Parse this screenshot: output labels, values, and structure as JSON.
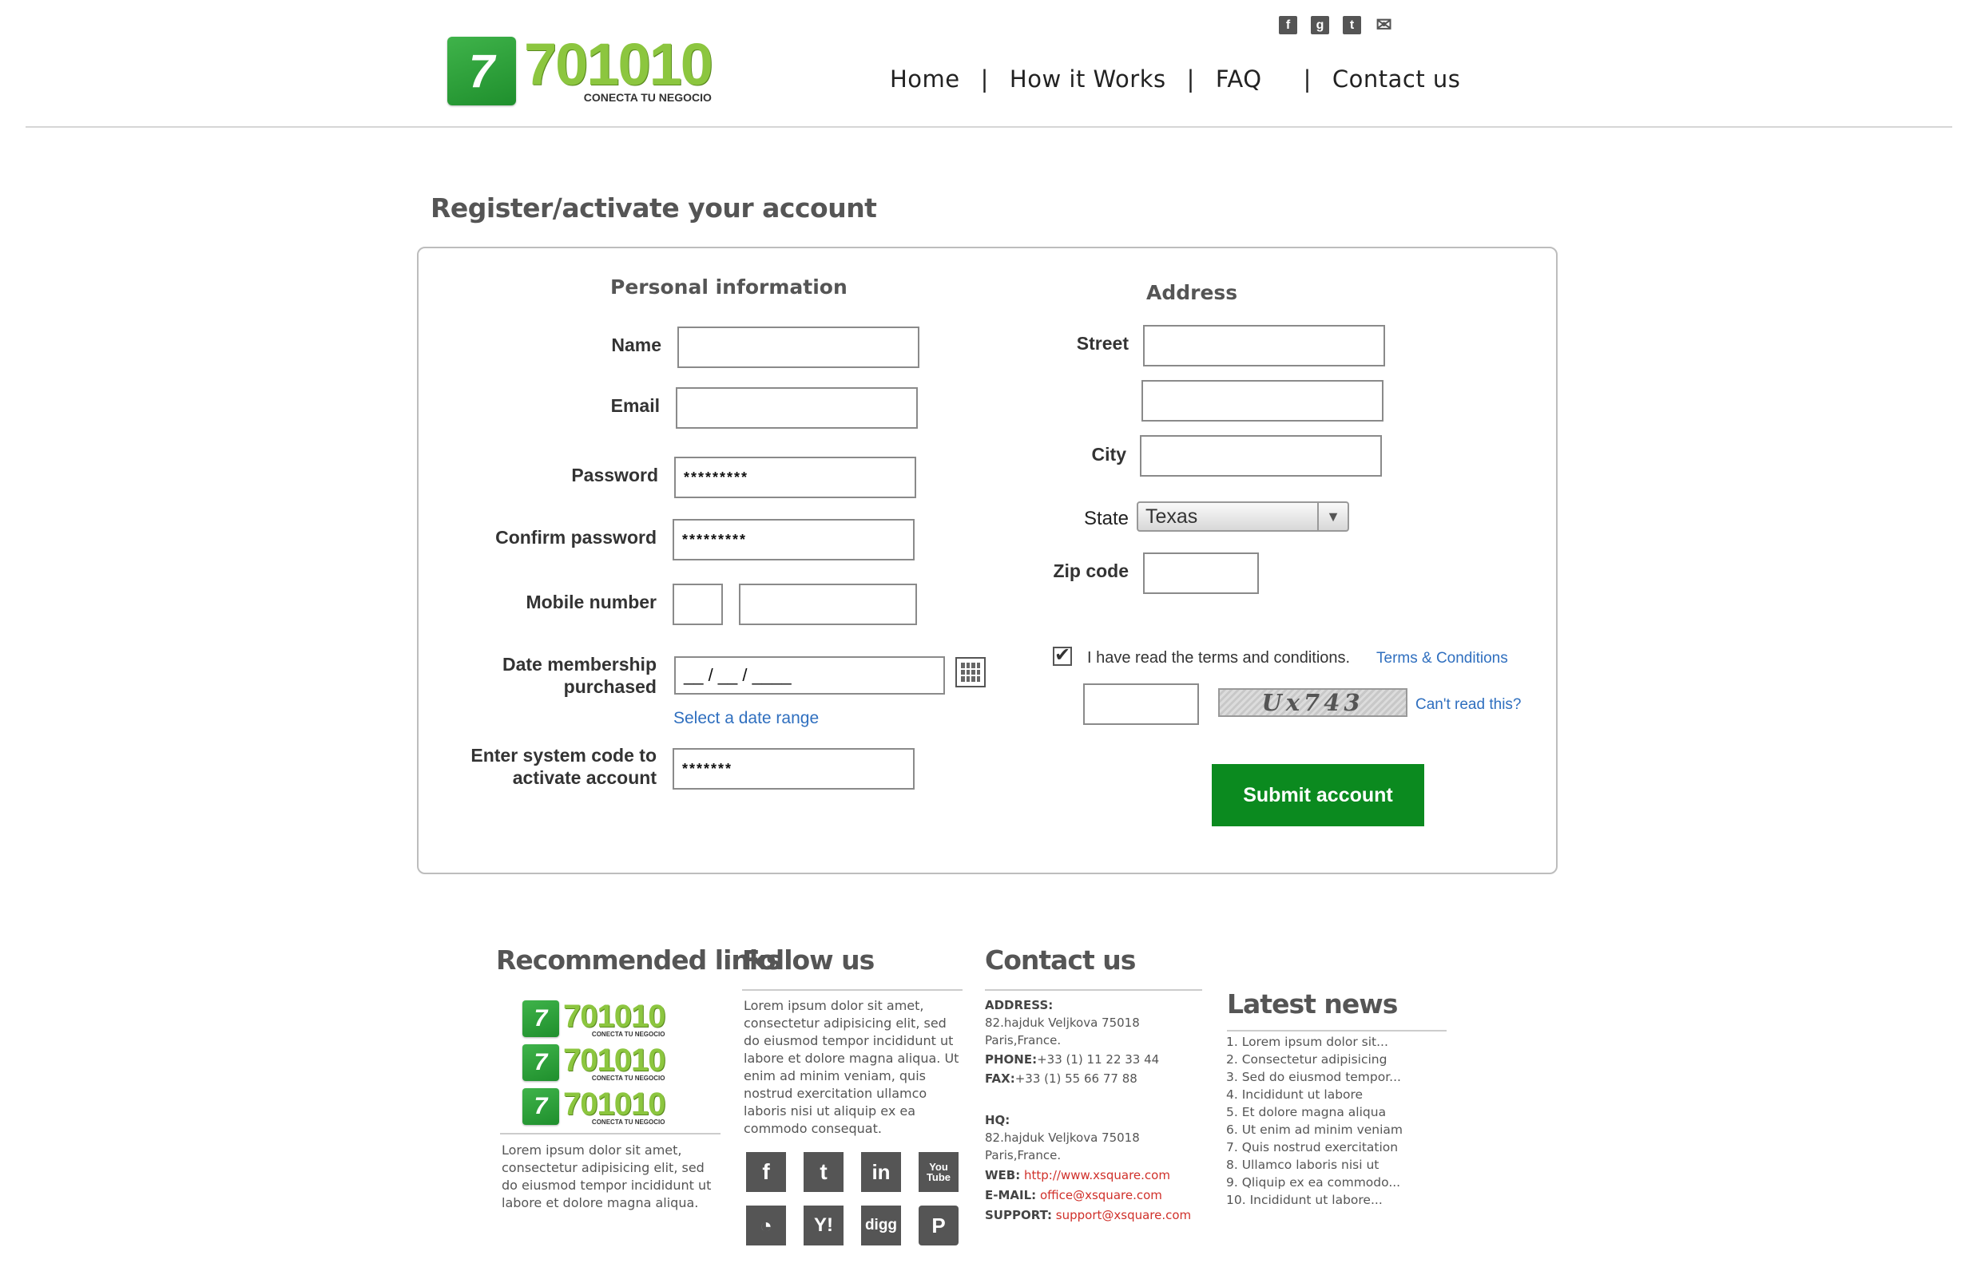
{
  "brand": {
    "number": "701010",
    "tagline": "CONECTA TU NEGOCIO",
    "accent": "#8cc63f",
    "primary_green": "#0b8a1f"
  },
  "social_top": [
    {
      "icon": "facebook-icon",
      "glyph": "f"
    },
    {
      "icon": "google-plus-icon",
      "glyph": "g"
    },
    {
      "icon": "twitter-icon",
      "glyph": "t"
    },
    {
      "icon": "mail-icon",
      "glyph": "✉"
    }
  ],
  "nav": {
    "home": "Home",
    "how": "How it Works",
    "faq": "FAQ",
    "contact": "Contact us",
    "separator": "|"
  },
  "page_title": "Register/activate your account",
  "personal": {
    "title": "Personal information",
    "name_label": "Name",
    "name_value": "",
    "email_label": "Email",
    "email_value": "",
    "password_label": "Password",
    "password_value": "*********",
    "confirm_label": "Confirm password",
    "confirm_value": "*********",
    "mobile_label": "Mobile number",
    "mobile_prefix": "",
    "mobile_value": "",
    "date_label_1": "Date membership",
    "date_label_2": "purchased",
    "date_value": "__ / __ / ____",
    "date_range_link": "Select a date range",
    "code_label_1": "Enter system code to",
    "code_label_2": "activate account",
    "code_value": "*******"
  },
  "address": {
    "title": "Address",
    "street_label": "Street",
    "street_1": "",
    "street_2": "",
    "city_label": "City",
    "city_value": "",
    "state_label": "State",
    "state_value": "Texas",
    "zip_label": "Zip code",
    "zip_value": ""
  },
  "terms": {
    "checked": true,
    "check_glyph": "✔",
    "text": "I have read the terms and conditions.",
    "link": "Terms & Conditions"
  },
  "captcha": {
    "input_value": "",
    "code": "Ux743",
    "cant_read": "Can't read this?"
  },
  "submit_label": "Submit account",
  "footer": {
    "recommended": {
      "title": "Recommended links",
      "text": "Lorem ipsum dolor sit amet, consectetur adipisicing elit, sed do eiusmod tempor incididunt ut labore et dolore magna aliqua."
    },
    "follow": {
      "title": "Follow us",
      "text": "Lorem ipsum dolor sit amet, consectetur adipisicing elit, sed do eiusmod tempor incididunt ut labore et dolore magna aliqua. Ut enim ad minim veniam, quis nostrud exercitation ullamco laboris nisi ut aliquip ex ea commodo consequat.",
      "icons": [
        {
          "name": "facebook-icon",
          "glyph": "f"
        },
        {
          "name": "twitter-icon",
          "glyph": "t"
        },
        {
          "name": "linkedin-icon",
          "glyph": "in"
        },
        {
          "name": "youtube-icon",
          "glyph": "You Tube"
        },
        {
          "name": "rss-icon",
          "glyph": "◔"
        },
        {
          "name": "yahoo-icon",
          "glyph": "Y!"
        },
        {
          "name": "digg-icon",
          "glyph": "digg"
        },
        {
          "name": "pinterest-icon",
          "glyph": "P"
        }
      ]
    },
    "contact": {
      "title": "Contact us",
      "address_label": "ADDRESS:",
      "address_1": "82.hajduk Veljkova 75018",
      "address_2": "Paris,France.",
      "phone_label": "PHONE:",
      "phone": "+33 (1) 11 22 33 44",
      "fax_label": "FAX:",
      "fax": "+33 (1) 55 66 77 88",
      "hq_label": "HQ:",
      "hq_1": "82.hajduk Veljkova 75018",
      "hq_2": "Paris,France.",
      "web_label": "WEB:",
      "web": "http://www.xsquare.com",
      "email_label": "E-MAIL:",
      "email": "office@xsquare.com",
      "support_label": "SUPPORT:",
      "support": "support@xsquare.com"
    },
    "news": {
      "title": "Latest news",
      "items": [
        "1. Lorem ipsum dolor sit...",
        "2. Consectetur adipisicing",
        "3. Sed do eiusmod tempor...",
        "4. Incididunt ut labore",
        "5. Et dolore magna aliqua",
        "6. Ut enim ad minim veniam",
        "7. Quis nostrud exercitation",
        "8. Ullamco laboris nisi ut",
        "9. Qliquip ex ea commodo...",
        "10. Incididunt ut labore..."
      ]
    }
  }
}
